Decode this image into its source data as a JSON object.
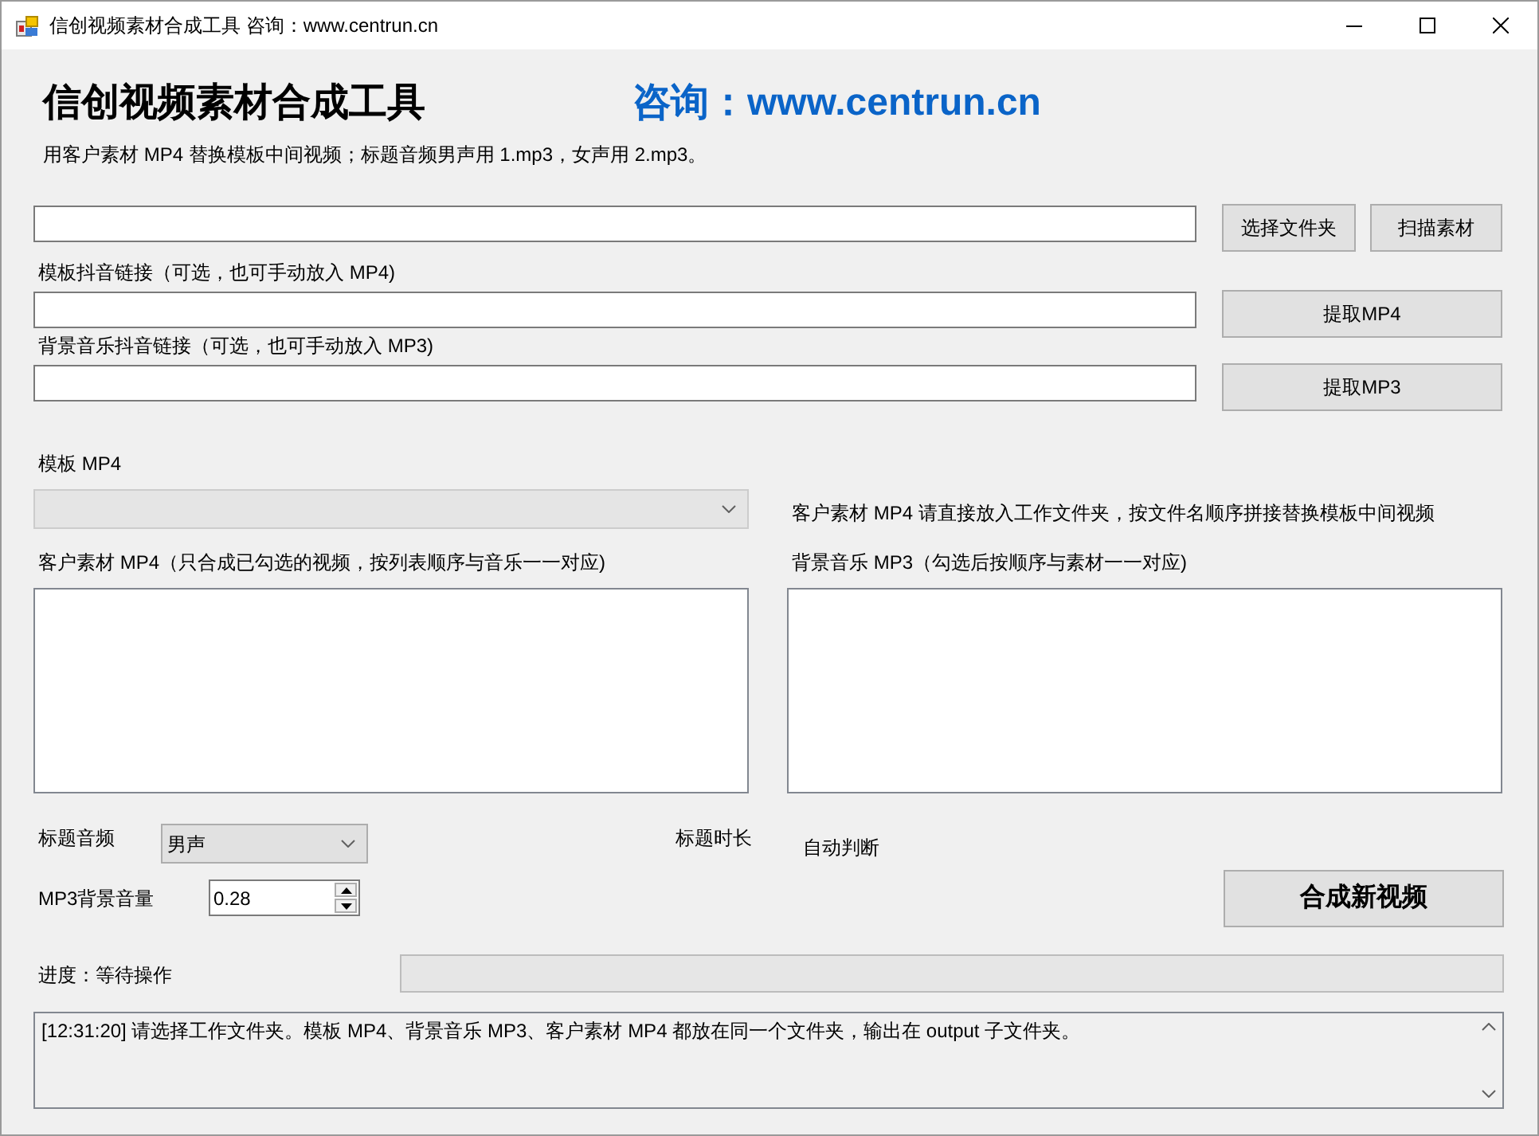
{
  "window": {
    "title": "信创视频素材合成工具 咨询：www.centrun.cn"
  },
  "header": {
    "title": "信创视频素材合成工具",
    "contact": "咨询：www.centrun.cn",
    "description": "用客户素材 MP4 替换模板中间视频；标题音频男声用 1.mp3，女声用 2.mp3。"
  },
  "folder": {
    "buttons": [
      "选择文件夹",
      "扫描素材"
    ]
  },
  "links": [
    {
      "label": "模板抖音链接（可选，也可手动放入 MP4)",
      "button": "提取MP4"
    },
    {
      "label": "背景音乐抖音链接（可选，也可手动放入 MP3)",
      "button": "提取MP3"
    }
  ],
  "template": {
    "label": "模板 MP4",
    "disabled": true
  },
  "note": "客户素材 MP4 请直接放入工作文件夹，按文件名顺序拼接替换模板中间视频",
  "lists": [
    {
      "label": "客户素材 MP4（只合成已勾选的视频，按列表顺序与音乐一一对应)"
    },
    {
      "label": "背景音乐 MP3（勾选后按顺序与素材一一对应)"
    }
  ],
  "title_audio": {
    "label": "标题音频",
    "value": "男声"
  },
  "title_duration": {
    "label": "标题时长",
    "value": "自动判断"
  },
  "volume": {
    "label": "MP3背景音量",
    "value": "0.28"
  },
  "compose_button": "合成新视频",
  "progress": {
    "label": "进度：等待操作",
    "level": 0
  },
  "log": [
    "[12:31:20] 请选择工作文件夹。模板 MP4、背景音乐 MP3、客户素材 MP4 都放在同一个文件夹，输出在 output 子文件夹。"
  ]
}
